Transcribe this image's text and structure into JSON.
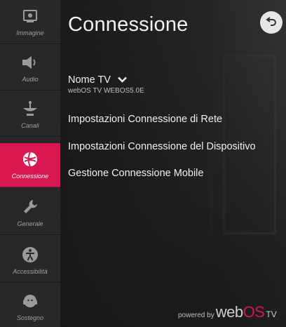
{
  "header": {
    "title": "Connessione"
  },
  "sidebar": {
    "items": [
      {
        "label": "Immagine",
        "icon": "picture-icon",
        "active": false
      },
      {
        "label": "Audio",
        "icon": "speaker-icon",
        "active": false
      },
      {
        "label": "Canali",
        "icon": "satellite-dish-icon",
        "active": false
      },
      {
        "label": "Connessione",
        "icon": "globe-network-icon",
        "active": true
      },
      {
        "label": "Generale",
        "icon": "wrench-icon",
        "active": false
      },
      {
        "label": "Accessibilità",
        "icon": "accessibility-icon",
        "active": false
      },
      {
        "label": "Sostegno",
        "icon": "support-icon",
        "active": false
      }
    ]
  },
  "main": {
    "tv_name": {
      "label": "Nome TV",
      "value": "webOS TV WEBOS5.0E"
    },
    "menu": [
      {
        "label": "Impostazioni Connessione di Rete"
      },
      {
        "label": "Impostazioni Connessione del Dispositivo"
      },
      {
        "label": "Gestione Connessione Mobile"
      }
    ]
  },
  "footer": {
    "powered": "powered by",
    "brand_web": "web",
    "brand_os": "OS",
    "brand_tv": "TV"
  },
  "colors": {
    "accent": "#d8164f",
    "sidebar_bg": "#282828",
    "text": "#f0f0f0"
  }
}
